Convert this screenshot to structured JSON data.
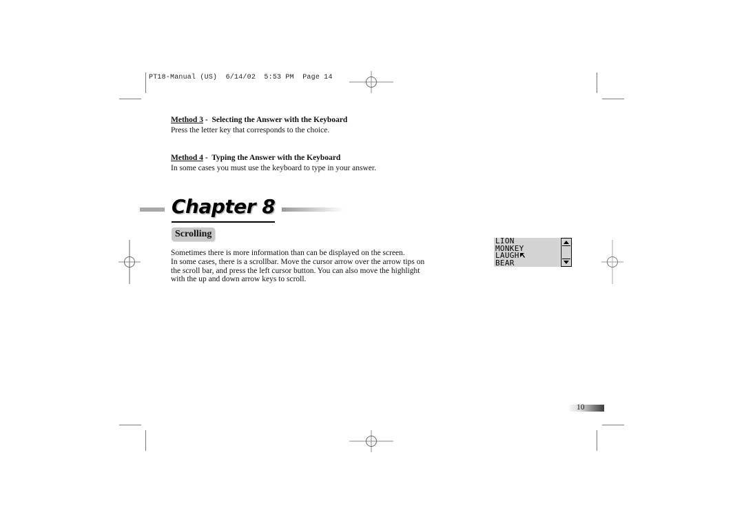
{
  "slug_line": "PT18-Manual (US)  6/14/02  5:53 PM  Page 14",
  "methods": [
    {
      "label": "Method 3",
      "separator": " -  ",
      "title": "Selecting the Answer with the Keyboard",
      "body": "Press the letter key that corresponds to the choice."
    },
    {
      "label": "Method 4",
      "separator": " -  ",
      "title": "Typing the Answer with the Keyboard",
      "body": "In some cases you must use the keyboard to type in your answer."
    }
  ],
  "chapter": {
    "title": "Chapter 8"
  },
  "section": {
    "title": "Scrolling",
    "paragraph_lines": [
      "Sometimes there is more information than can be displayed on the screen.",
      "In some cases, there is a scrollbar. Move the cursor arrow over the arrow tips on",
      "the scroll bar, and press the left cursor button. You can also move the highlight",
      "with the up and down arrow keys to scroll."
    ]
  },
  "lcd_screen": {
    "items": [
      "LION",
      "MONKEY",
      "LAUGH",
      "BEAR"
    ],
    "cursor_on_item": "LAUGH",
    "scroll_up_icon": "up-arrow",
    "scroll_down_icon": "down-arrow"
  },
  "page_number": "10"
}
